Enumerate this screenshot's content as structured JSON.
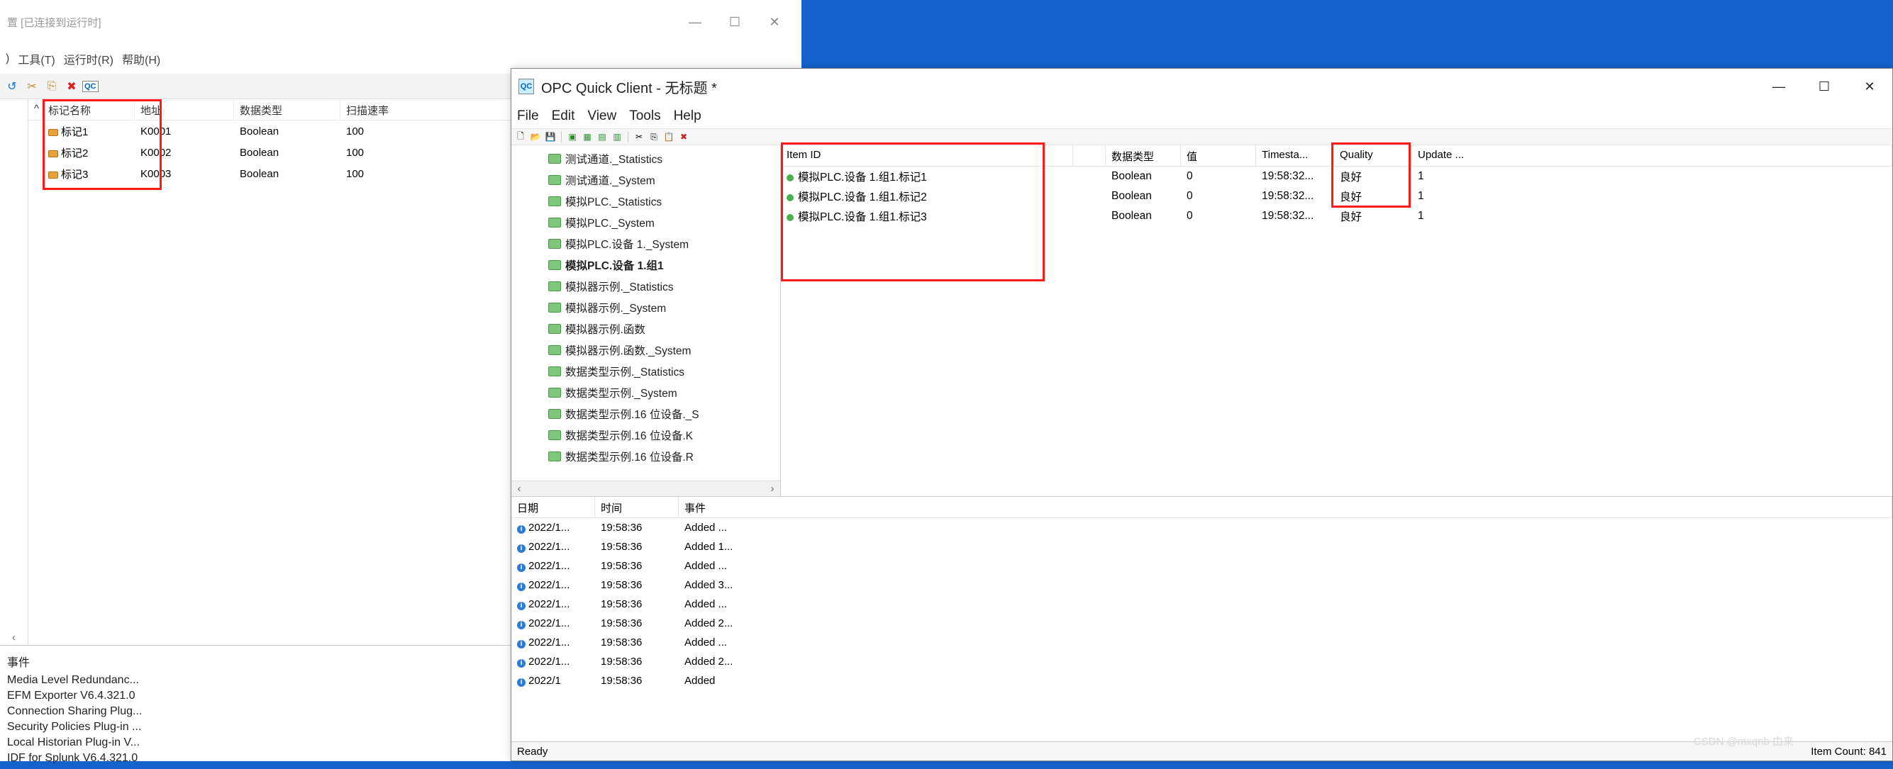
{
  "leftWindow": {
    "title": "置 [已连接到运行时]",
    "menus": [
      "工具(T)",
      "运行时(R)",
      "帮助(H)"
    ],
    "columns": {
      "name": "标记名称",
      "addr": "地址",
      "dtype": "数据类型",
      "scan": "扫描速率"
    },
    "rows": [
      {
        "name": "标记1",
        "addr": "K0001",
        "dtype": "Boolean",
        "scan": "100"
      },
      {
        "name": "标记2",
        "addr": "K0002",
        "dtype": "Boolean",
        "scan": "100"
      },
      {
        "name": "标记3",
        "addr": "K0003",
        "dtype": "Boolean",
        "scan": "100"
      }
    ],
    "eventsHeader": "事件",
    "events": [
      "Media Level Redundanc...",
      "EFM Exporter V6.4.321.0",
      "Connection Sharing Plug...",
      "Security Policies Plug-in ...",
      "Local Historian Plug-in V...",
      "IDF for Splunk V6.4.321.0"
    ]
  },
  "rightWindow": {
    "title": "OPC Quick Client - 无标题 *",
    "menus": [
      "File",
      "Edit",
      "View",
      "Tools",
      "Help"
    ],
    "tree": [
      {
        "label": "测试通道._Statistics",
        "sel": false
      },
      {
        "label": "测试通道._System",
        "sel": false
      },
      {
        "label": "模拟PLC._Statistics",
        "sel": false
      },
      {
        "label": "模拟PLC._System",
        "sel": false
      },
      {
        "label": "模拟PLC.设备 1._System",
        "sel": false
      },
      {
        "label": "模拟PLC.设备 1.组1",
        "sel": true
      },
      {
        "label": "模拟器示例._Statistics",
        "sel": false
      },
      {
        "label": "模拟器示例._System",
        "sel": false
      },
      {
        "label": "模拟器示例.函数",
        "sel": false
      },
      {
        "label": "模拟器示例.函数._System",
        "sel": false
      },
      {
        "label": "数据类型示例._Statistics",
        "sel": false
      },
      {
        "label": "数据类型示例._System",
        "sel": false
      },
      {
        "label": "数据类型示例.16 位设备._S",
        "sel": false
      },
      {
        "label": "数据类型示例.16 位设备.K",
        "sel": false
      },
      {
        "label": "数据类型示例.16 位设备.R",
        "sel": false
      }
    ],
    "gridCols": {
      "item": "Item ID",
      "dtype": "数据类型",
      "val": "值",
      "ts": "Timesta...",
      "q": "Quality",
      "up": "Update ..."
    },
    "gridRows": [
      {
        "item": "模拟PLC.设备 1.组1.标记1",
        "dtype": "Boolean",
        "val": "0",
        "ts": "19:58:32...",
        "q": "良好",
        "up": "1"
      },
      {
        "item": "模拟PLC.设备 1.组1.标记2",
        "dtype": "Boolean",
        "val": "0",
        "ts": "19:58:32...",
        "q": "良好",
        "up": "1"
      },
      {
        "item": "模拟PLC.设备 1.组1.标记3",
        "dtype": "Boolean",
        "val": "0",
        "ts": "19:58:32...",
        "q": "良好",
        "up": "1"
      }
    ],
    "logCols": {
      "date": "日期",
      "time": "时间",
      "ev": "事件"
    },
    "logRows": [
      {
        "date": "2022/1...",
        "time": "19:58:36",
        "ev": "Added ..."
      },
      {
        "date": "2022/1...",
        "time": "19:58:36",
        "ev": "Added 1..."
      },
      {
        "date": "2022/1...",
        "time": "19:58:36",
        "ev": "Added ..."
      },
      {
        "date": "2022/1...",
        "time": "19:58:36",
        "ev": "Added 3..."
      },
      {
        "date": "2022/1...",
        "time": "19:58:36",
        "ev": "Added ..."
      },
      {
        "date": "2022/1...",
        "time": "19:58:36",
        "ev": "Added 2..."
      },
      {
        "date": "2022/1...",
        "time": "19:58:36",
        "ev": "Added ..."
      },
      {
        "date": "2022/1...",
        "time": "19:58:36",
        "ev": "Added 2..."
      },
      {
        "date": "2022/1",
        "time": "19:58:36",
        "ev": "Added"
      }
    ],
    "status": {
      "ready": "Ready",
      "count": "Item Count: 841"
    }
  },
  "watermark": "CSDN @mxqnb 由来"
}
